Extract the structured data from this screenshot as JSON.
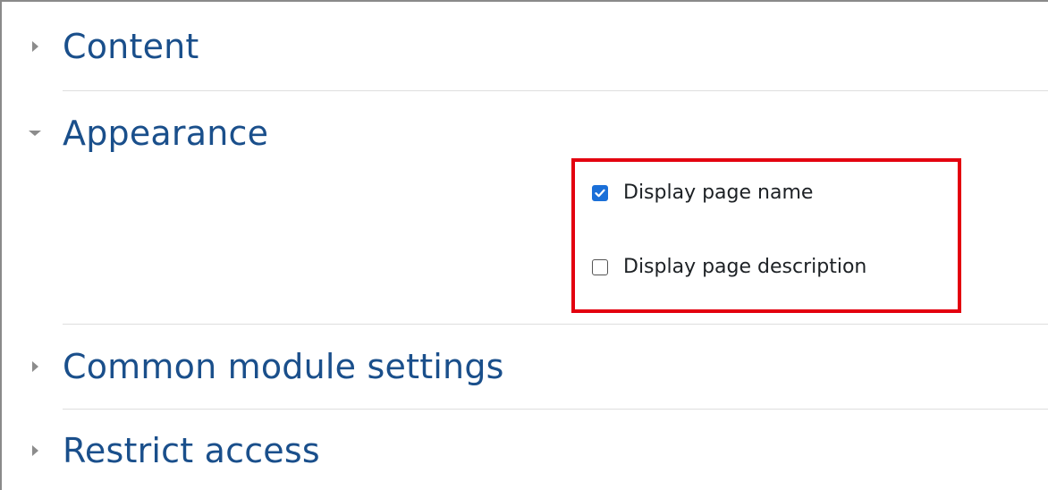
{
  "sections": [
    {
      "title": "Content",
      "state": "collapsed"
    },
    {
      "title": "Appearance",
      "state": "expanded"
    },
    {
      "title": "Common module settings",
      "state": "collapsed"
    },
    {
      "title": "Restrict access",
      "state": "collapsed"
    }
  ],
  "appearance": {
    "options": [
      {
        "label": "Display page name",
        "checked": true
      },
      {
        "label": "Display page description",
        "checked": false
      }
    ]
  },
  "colors": {
    "section_title": "#1a4f8b",
    "checkbox_checked": "#1a6fd8",
    "highlight_border": "#e3000f",
    "divider": "#dedede"
  },
  "icons": {
    "collapsed": "caret-right-icon",
    "expanded": "caret-down-icon",
    "checked": "checkmark-icon"
  }
}
